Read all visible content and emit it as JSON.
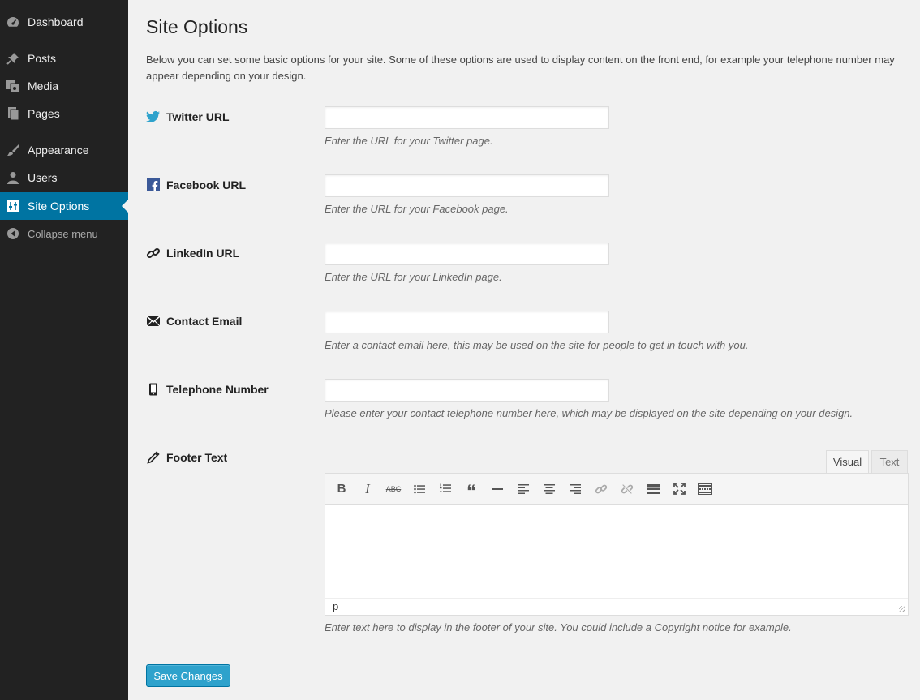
{
  "sidebar": {
    "items": [
      {
        "label": "Dashboard",
        "icon": "dashboard-icon"
      },
      {
        "label": "Posts",
        "icon": "pin-icon"
      },
      {
        "label": "Media",
        "icon": "media-icon"
      },
      {
        "label": "Pages",
        "icon": "pages-icon"
      },
      {
        "label": "Appearance",
        "icon": "brush-icon"
      },
      {
        "label": "Users",
        "icon": "user-icon"
      },
      {
        "label": "Site Options",
        "icon": "sliders-icon",
        "active": true
      },
      {
        "label": "Collapse menu",
        "icon": "collapse-icon"
      }
    ]
  },
  "page": {
    "title": "Site Options",
    "intro": "Below you can set some basic options for your site. Some of these options are used to display content on the front end, for example your telephone number may appear depending on your design."
  },
  "fields": {
    "twitter": {
      "label": "Twitter URL",
      "value": "",
      "description": "Enter the URL for your Twitter page.",
      "icon": "twitter-icon"
    },
    "facebook": {
      "label": "Facebook URL",
      "value": "",
      "description": "Enter the URL for your Facebook page.",
      "icon": "facebook-icon"
    },
    "linkedin": {
      "label": "LinkedIn URL",
      "value": "",
      "description": "Enter the URL for your LinkedIn page.",
      "icon": "link-icon"
    },
    "email": {
      "label": "Contact Email",
      "value": "",
      "description": "Enter a contact email here, this may be used on the site for people to get in touch with you.",
      "icon": "envelope-icon"
    },
    "telephone": {
      "label": "Telephone Number",
      "value": "",
      "description": "Please enter your contact telephone number here, which may be displayed on the site depending on your design.",
      "icon": "phone-icon"
    },
    "footer": {
      "label": "Footer Text",
      "description": "Enter text here to display in the footer of your site. You could include a Copyright notice for example.",
      "icon": "pencil-icon"
    }
  },
  "editor": {
    "tab_visual": "Visual",
    "tab_text": "Text",
    "path": "p",
    "toolbar": [
      "bold-icon",
      "italic-icon",
      "strikethrough-icon",
      "bullet-list-icon",
      "numbered-list-icon",
      "blockquote-icon",
      "horizontal-rule-icon",
      "align-left-icon",
      "align-center-icon",
      "align-right-icon",
      "link-icon",
      "unlink-icon",
      "read-more-icon",
      "fullscreen-icon",
      "toolbar-toggle-icon"
    ],
    "toolbar_glyphs": {
      "bold": "B",
      "italic": "I",
      "strike": "ABC",
      "quote": "“"
    }
  },
  "actions": {
    "save_label": "Save Changes"
  },
  "colors": {
    "accent": "#0074a2",
    "button": "#2ea2cc",
    "sidebar": "#222222"
  }
}
